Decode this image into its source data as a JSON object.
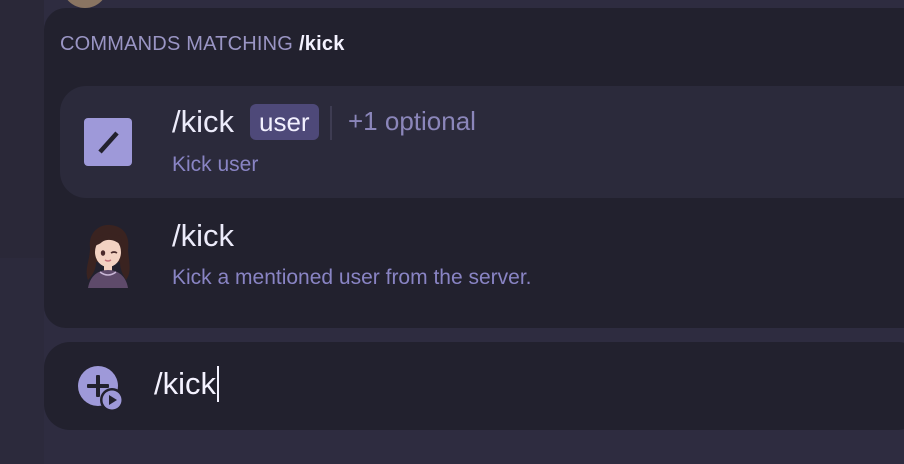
{
  "autocomplete": {
    "header_label": "COMMANDS MATCHING",
    "header_query": "/kick",
    "commands": [
      {
        "name": "/kick",
        "required_param": "user",
        "optional_label": "+1 optional",
        "description": "Kick user",
        "icon": "slash-command-icon",
        "selected": true
      },
      {
        "name": "/kick",
        "description": "Kick a mentioned user from the server.",
        "icon": "bot-avatar",
        "selected": false
      }
    ]
  },
  "composer": {
    "value": "/kick",
    "attach_icon": "add-app-plus-icon"
  },
  "colors": {
    "background": "#2e2c40",
    "panel": "#22212e",
    "selected_row": "#2b2a3b",
    "accent": "#9e99d9",
    "chip": "#4e4979",
    "muted_text": "#8984c4"
  }
}
